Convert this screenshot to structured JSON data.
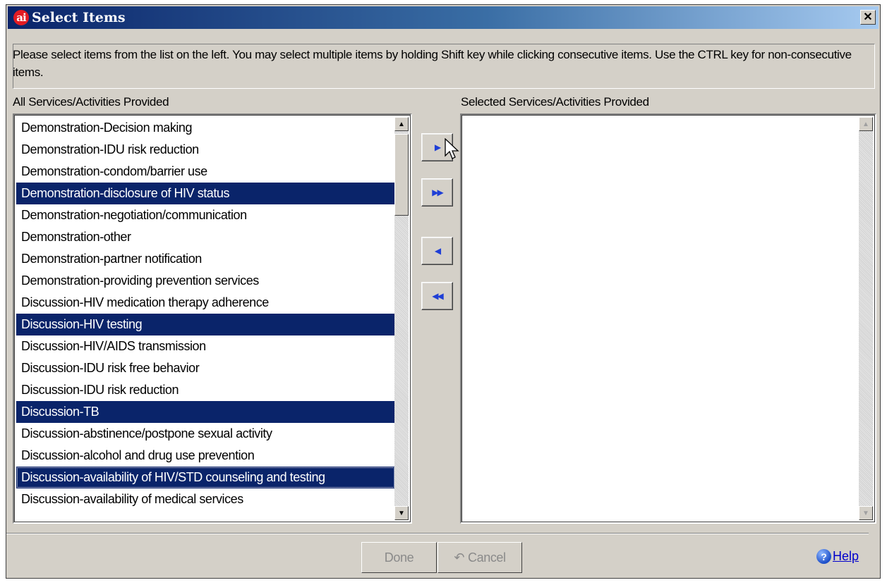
{
  "window": {
    "title": "Select Items",
    "app_icon_text": "ai",
    "close_glyph": "✕"
  },
  "instructions": "Please select items from the list on the left. You may select multiple items by holding Shift key while clicking consecutive items. Use the CTRL key for non-consecutive items.",
  "left_list": {
    "label": "All Services/Activities Provided",
    "items": [
      {
        "label": "Demonstration-Decision making",
        "selected": false
      },
      {
        "label": "Demonstration-IDU risk reduction",
        "selected": false
      },
      {
        "label": "Demonstration-condom/barrier use",
        "selected": false
      },
      {
        "label": "Demonstration-disclosure of HIV status",
        "selected": true
      },
      {
        "label": "Demonstration-negotiation/communication",
        "selected": false
      },
      {
        "label": "Demonstration-other",
        "selected": false
      },
      {
        "label": "Demonstration-partner notification",
        "selected": false
      },
      {
        "label": "Demonstration-providing prevention services",
        "selected": false
      },
      {
        "label": "Discussion-HIV medication therapy adherence",
        "selected": false
      },
      {
        "label": "Discussion-HIV testing",
        "selected": true
      },
      {
        "label": "Discussion-HIV/AIDS transmission",
        "selected": false
      },
      {
        "label": "Discussion-IDU risk free behavior",
        "selected": false
      },
      {
        "label": "Discussion-IDU risk reduction",
        "selected": false
      },
      {
        "label": "Discussion-TB",
        "selected": true
      },
      {
        "label": "Discussion-abstinence/postpone sexual activity",
        "selected": false
      },
      {
        "label": "Discussion-alcohol and drug use prevention",
        "selected": false
      },
      {
        "label": "Discussion-availability of HIV/STD counseling and testing",
        "selected": true,
        "focused": true
      },
      {
        "label": "Discussion-availability of medical services",
        "selected": false
      }
    ]
  },
  "right_list": {
    "label": "Selected Services/Activities Provided",
    "items": []
  },
  "transfer_buttons": {
    "move_selected": "▶",
    "move_all": "▶▶",
    "remove_selected": "◀",
    "remove_all": "◀◀"
  },
  "footer": {
    "done_label": "Done",
    "cancel_label": "Cancel",
    "cancel_glyph": "↶",
    "help_label": "Help",
    "help_glyph": "?"
  },
  "colors": {
    "selection": "#0a246a",
    "face": "#d4d0c8",
    "arrow": "#1f3fd6"
  }
}
